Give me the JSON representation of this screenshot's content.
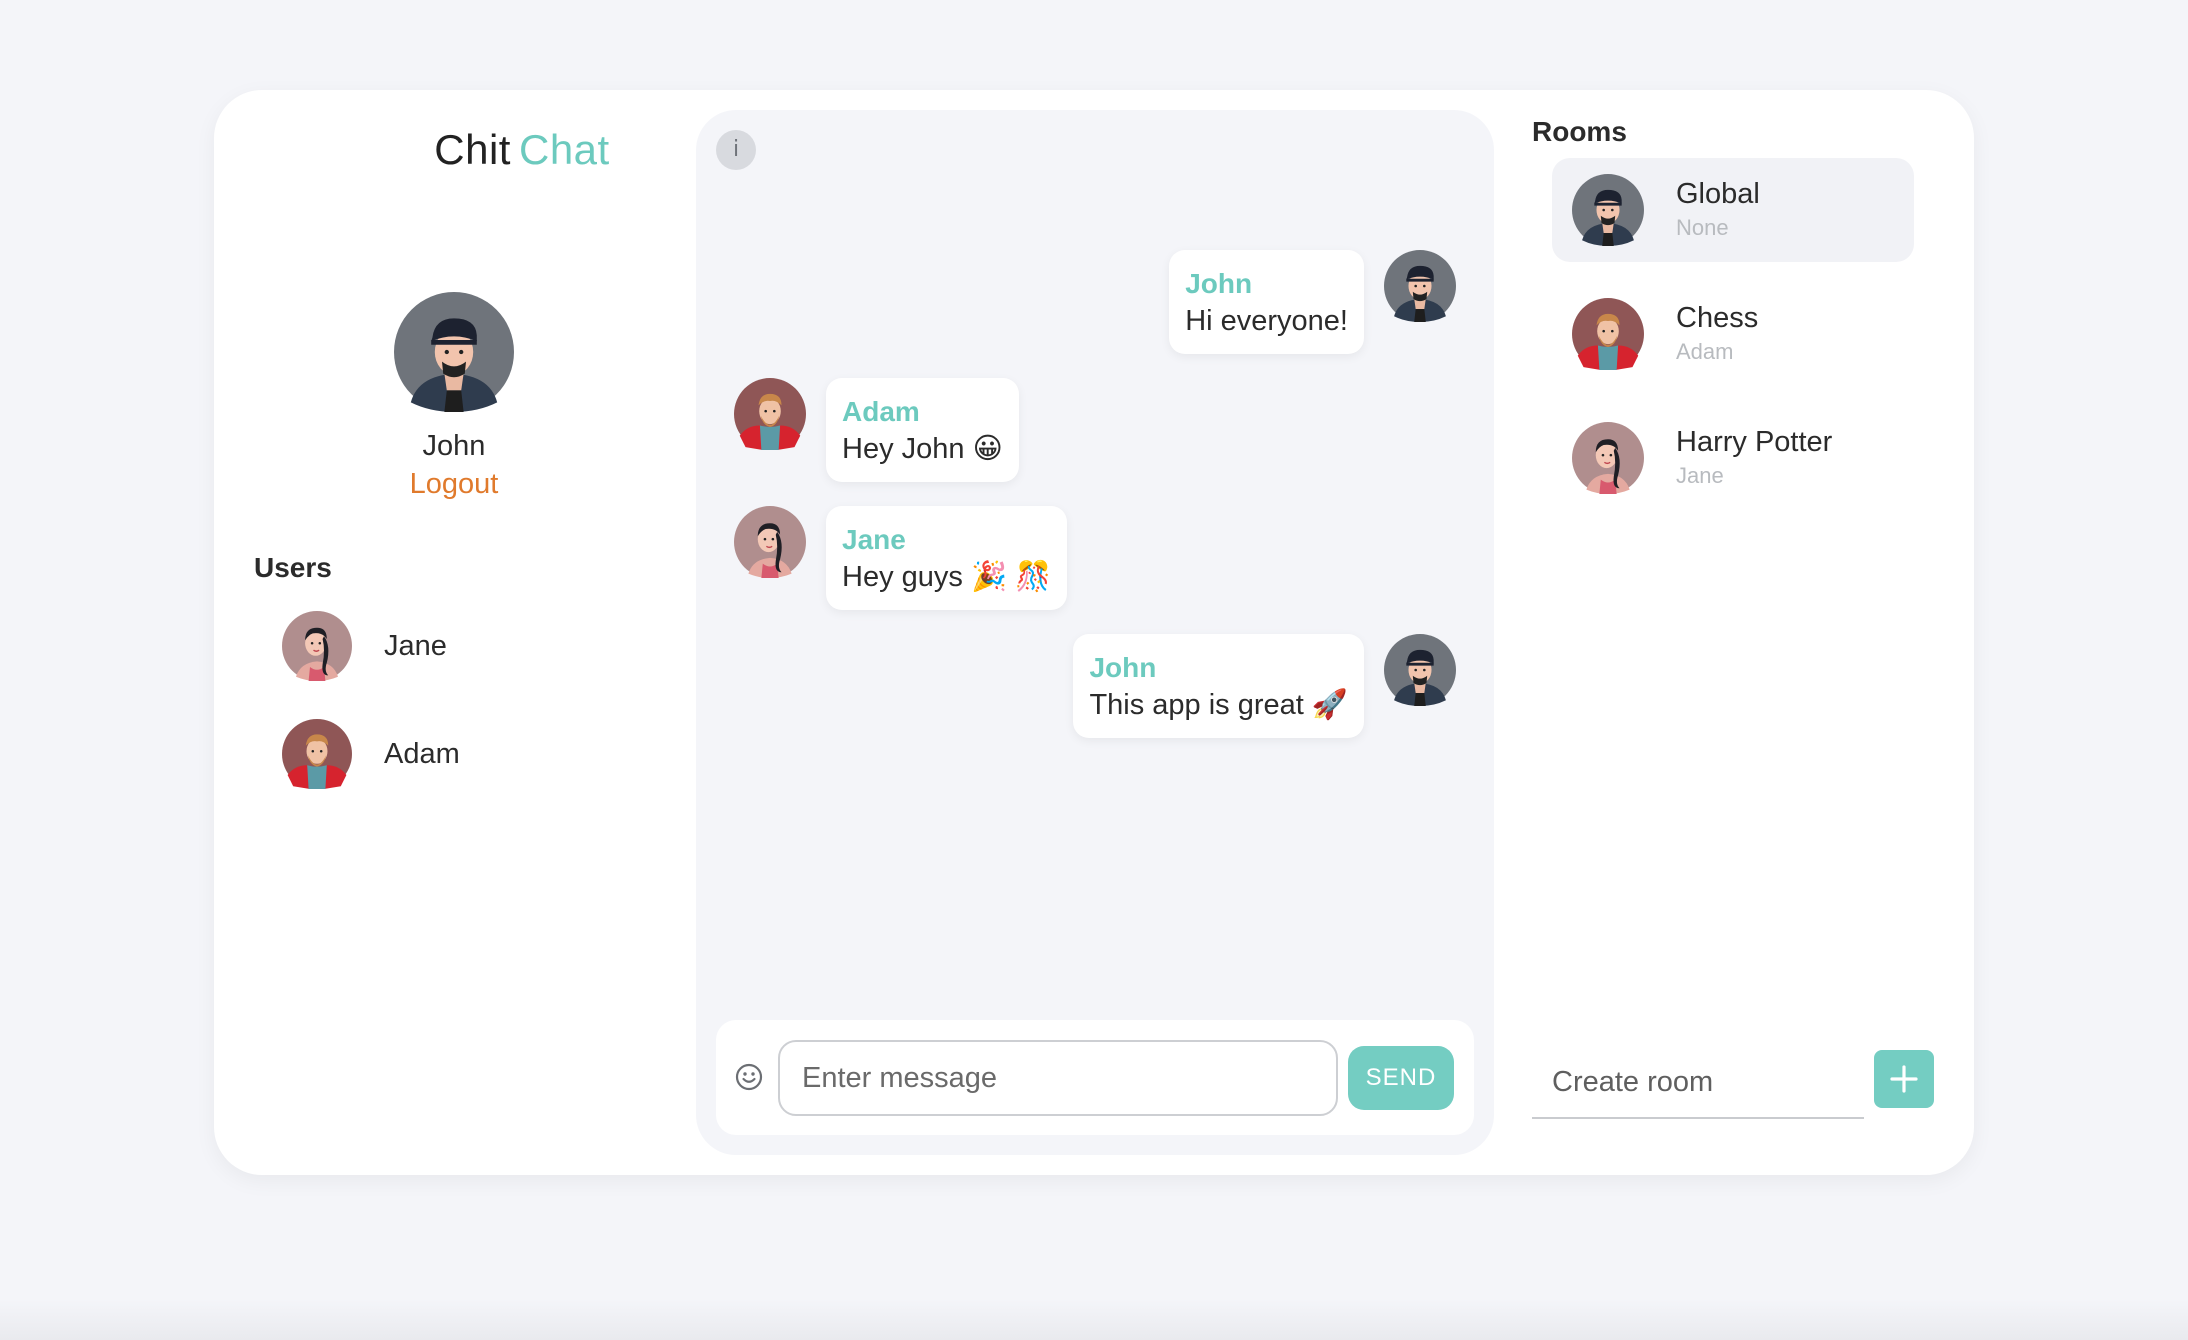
{
  "brand": {
    "part1": "Chit",
    "part2": "Chat"
  },
  "profile": {
    "name": "John",
    "logout_label": "Logout",
    "avatar_icon": "john-avatar-icon"
  },
  "users": {
    "title": "Users",
    "items": [
      {
        "name": "Jane",
        "avatar_icon": "jane-avatar-icon"
      },
      {
        "name": "Adam",
        "avatar_icon": "adam-avatar-icon"
      }
    ]
  },
  "chat": {
    "info_label": "i",
    "messages": [
      {
        "sender": "John",
        "text": "Hi everyone!",
        "side": "right"
      },
      {
        "sender": "Adam",
        "text": "Hey John 😀",
        "side": "left"
      },
      {
        "sender": "Jane",
        "text": "Hey guys 🎉 🎊",
        "side": "left"
      },
      {
        "sender": "John",
        "text": "This app is great 🚀",
        "side": "right"
      }
    ],
    "input_placeholder": "Enter message",
    "send_label": "SEND"
  },
  "rooms": {
    "title": "Rooms",
    "items": [
      {
        "name": "Global",
        "owner": "None",
        "active": true
      },
      {
        "name": "Chess",
        "owner": "Adam",
        "active": false
      },
      {
        "name": "Harry Potter",
        "owner": "Jane",
        "active": false
      }
    ],
    "create_placeholder": "Create room",
    "add_label": "+"
  },
  "colors": {
    "accent": "#74cdc2",
    "logout": "#e07a2c",
    "panel": "#f4f5f9"
  }
}
